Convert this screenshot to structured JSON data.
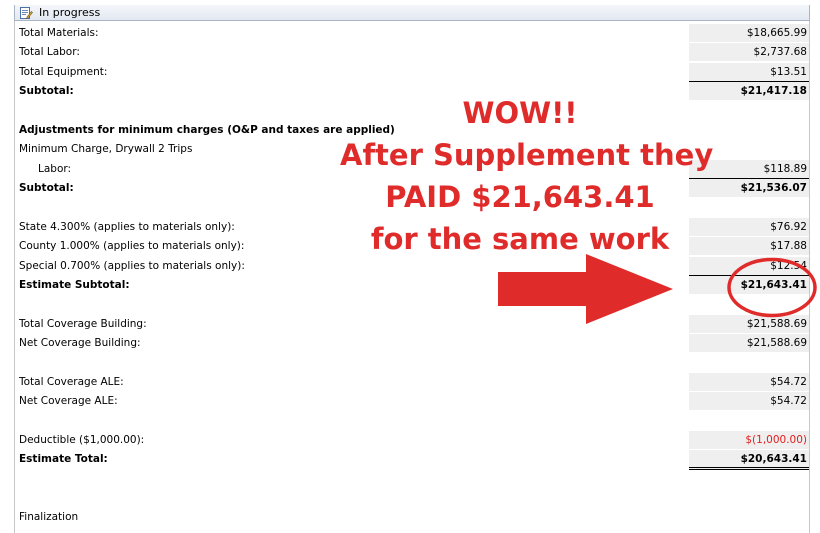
{
  "header": {
    "title": "In progress"
  },
  "rows": [
    {
      "label": "Total Materials:",
      "value": "$18,665.99"
    },
    {
      "label": "Total Labor:",
      "value": "$2,737.68"
    },
    {
      "label": "Total Equipment:",
      "value": "$13.51"
    },
    {
      "label": "Subtotal:",
      "value": "$21,417.18"
    },
    {
      "label": "Adjustments for minimum charges (O&P and taxes are applied)"
    },
    {
      "label": "Minimum Charge, Drywall 2 Trips"
    },
    {
      "label": "Labor:",
      "value": "$118.89"
    },
    {
      "label": "Subtotal:",
      "value": "$21,536.07"
    },
    {
      "label": "State 4.300% (applies to materials only):",
      "value": "$76.92"
    },
    {
      "label": "County 1.000% (applies to materials only):",
      "value": "$17.88"
    },
    {
      "label": "Special 0.700% (applies to materials only):",
      "value": "$12.54"
    },
    {
      "label": "Estimate Subtotal:",
      "value": "$21,643.41"
    },
    {
      "label": "Total Coverage Building:",
      "value": "$21,588.69"
    },
    {
      "label": "Net Coverage Building:",
      "value": "$21,588.69"
    },
    {
      "label": "Total Coverage ALE:",
      "value": "$54.72"
    },
    {
      "label": "Net Coverage ALE:",
      "value": "$54.72"
    },
    {
      "label": "Deductible ($1,000.00):",
      "value": "$(1,000.00)"
    },
    {
      "label": "Estimate Total:",
      "value": "$20,643.41"
    },
    {
      "label": "Finalization"
    }
  ],
  "annotation": {
    "line1": "WOW!!",
    "line2": "After Supplement they",
    "line3": "PAID $21,643.41",
    "line4": "for the same work"
  },
  "colors": {
    "annotation": "#e02b2b",
    "deductible": "#e02020"
  }
}
